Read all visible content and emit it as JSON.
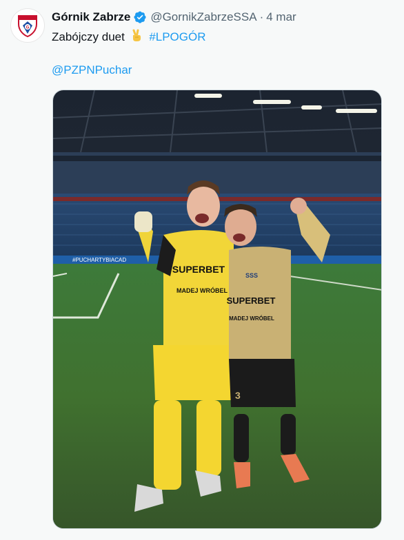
{
  "tweet": {
    "author_name": "Górnik Zabrze",
    "handle": "@GornikZabrzeSSA",
    "separator": "·",
    "timestamp": "4 mar",
    "text_main": "Zabójczy duet",
    "emoji": "victory-hand",
    "hashtag": "#LPOGÓR",
    "mention": "@PZPNPuchar",
    "verified": true,
    "avatar": "gornik-zabrze-crest"
  },
  "photo": {
    "shirt_sponsor": "SUPERBET",
    "shirt_sponsor_2": "SUPERBET",
    "shirt_brand": "MADEJ WRÓBEL",
    "shirt_brand_2": "MADEJ WRÓBEL",
    "banner_text": "#PUCHARTYBIACAD",
    "shirt_number": "3",
    "logo_text": "SSS"
  },
  "colors": {
    "link": "#1d9bf0",
    "muted": "#536471",
    "verified": "#1d9bf0"
  }
}
